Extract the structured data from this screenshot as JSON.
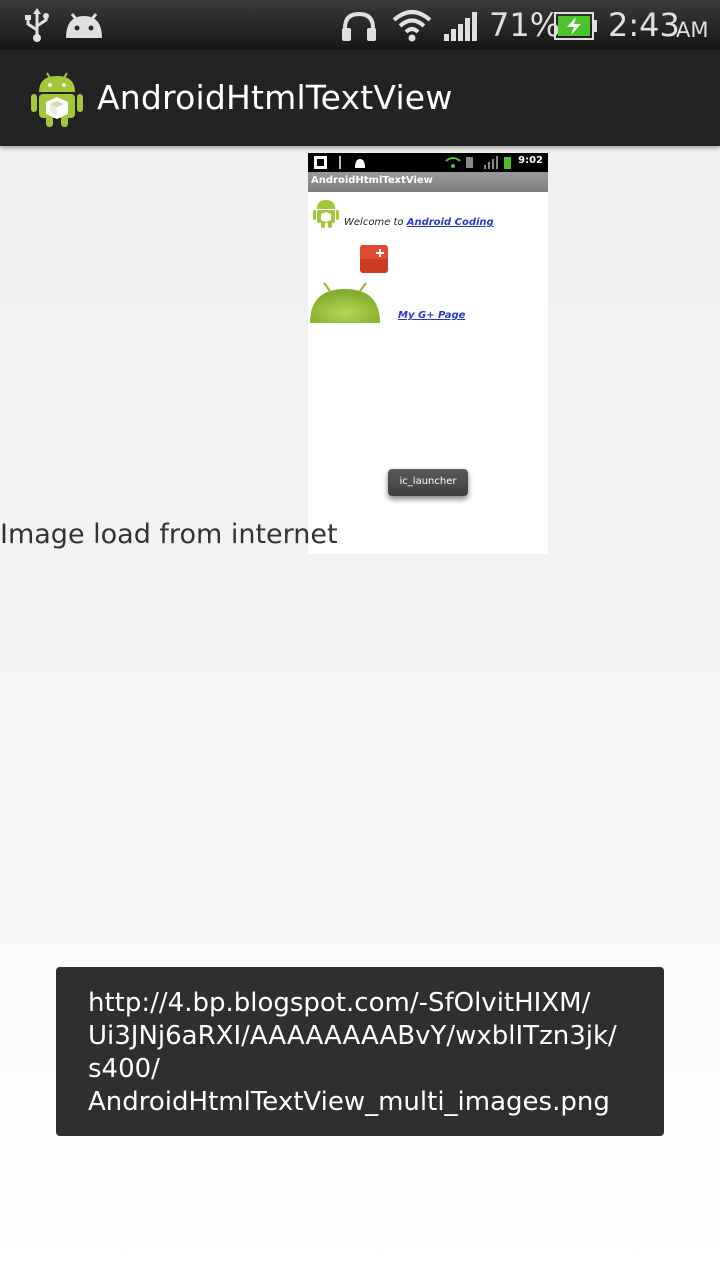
{
  "status_bar": {
    "icons": [
      "usb-icon",
      "android-debug-icon",
      "headphones-icon",
      "wifi-icon",
      "signal-icon",
      "battery-charging-icon"
    ],
    "battery_percent": "71%",
    "time": "2:43",
    "ampm": "AM"
  },
  "action_bar": {
    "title": "AndroidHtmlTextView",
    "icon": "android-launcher-icon"
  },
  "embedded_screenshot": {
    "status_time": "9:02",
    "title": "AndroidHtmlTextView",
    "welcome_prefix": "Welcome to ",
    "welcome_link": "Android Coding",
    "gplus_link": "My G+ Page",
    "toast": "ic_launcher"
  },
  "caption": "Image load from internet",
  "toast": {
    "message": "http://4.bp.blogspot.com/-SfOlvitHIXM/\nUi3JNj6aRXI/AAAAAAAABvY/wxblITzn3jk/\ns400/\nAndroidHtmlTextView_multi_images.png"
  },
  "colors": {
    "action_bar": "#232323",
    "status_bar": "#161616",
    "battery": "#4cc32a",
    "android_green": "#a4c639",
    "link": "#2a39c8",
    "toast": "#2f2f2f"
  }
}
